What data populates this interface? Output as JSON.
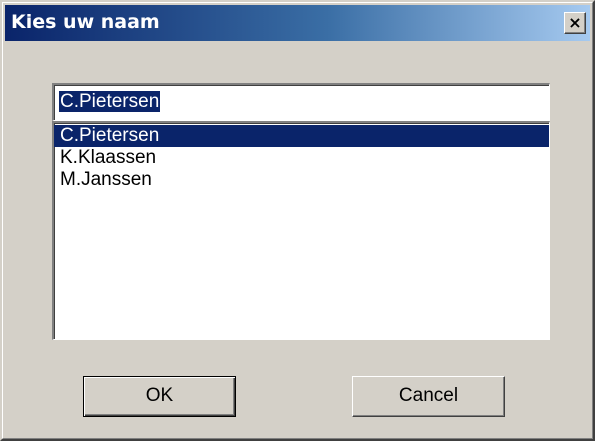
{
  "window": {
    "title": "Kies uw naam",
    "close_label": "×"
  },
  "name_input": {
    "value": "C.Pietersen"
  },
  "name_list": {
    "items": [
      {
        "label": "C.Pietersen",
        "selected": true
      },
      {
        "label": "K.Klaassen",
        "selected": false
      },
      {
        "label": "M.Janssen",
        "selected": false
      }
    ]
  },
  "buttons": {
    "ok_label": "OK",
    "cancel_label": "Cancel"
  },
  "colors": {
    "selection": "#0a246a",
    "face": "#d4d0c8"
  },
  "icons": {
    "close": "close-icon"
  }
}
